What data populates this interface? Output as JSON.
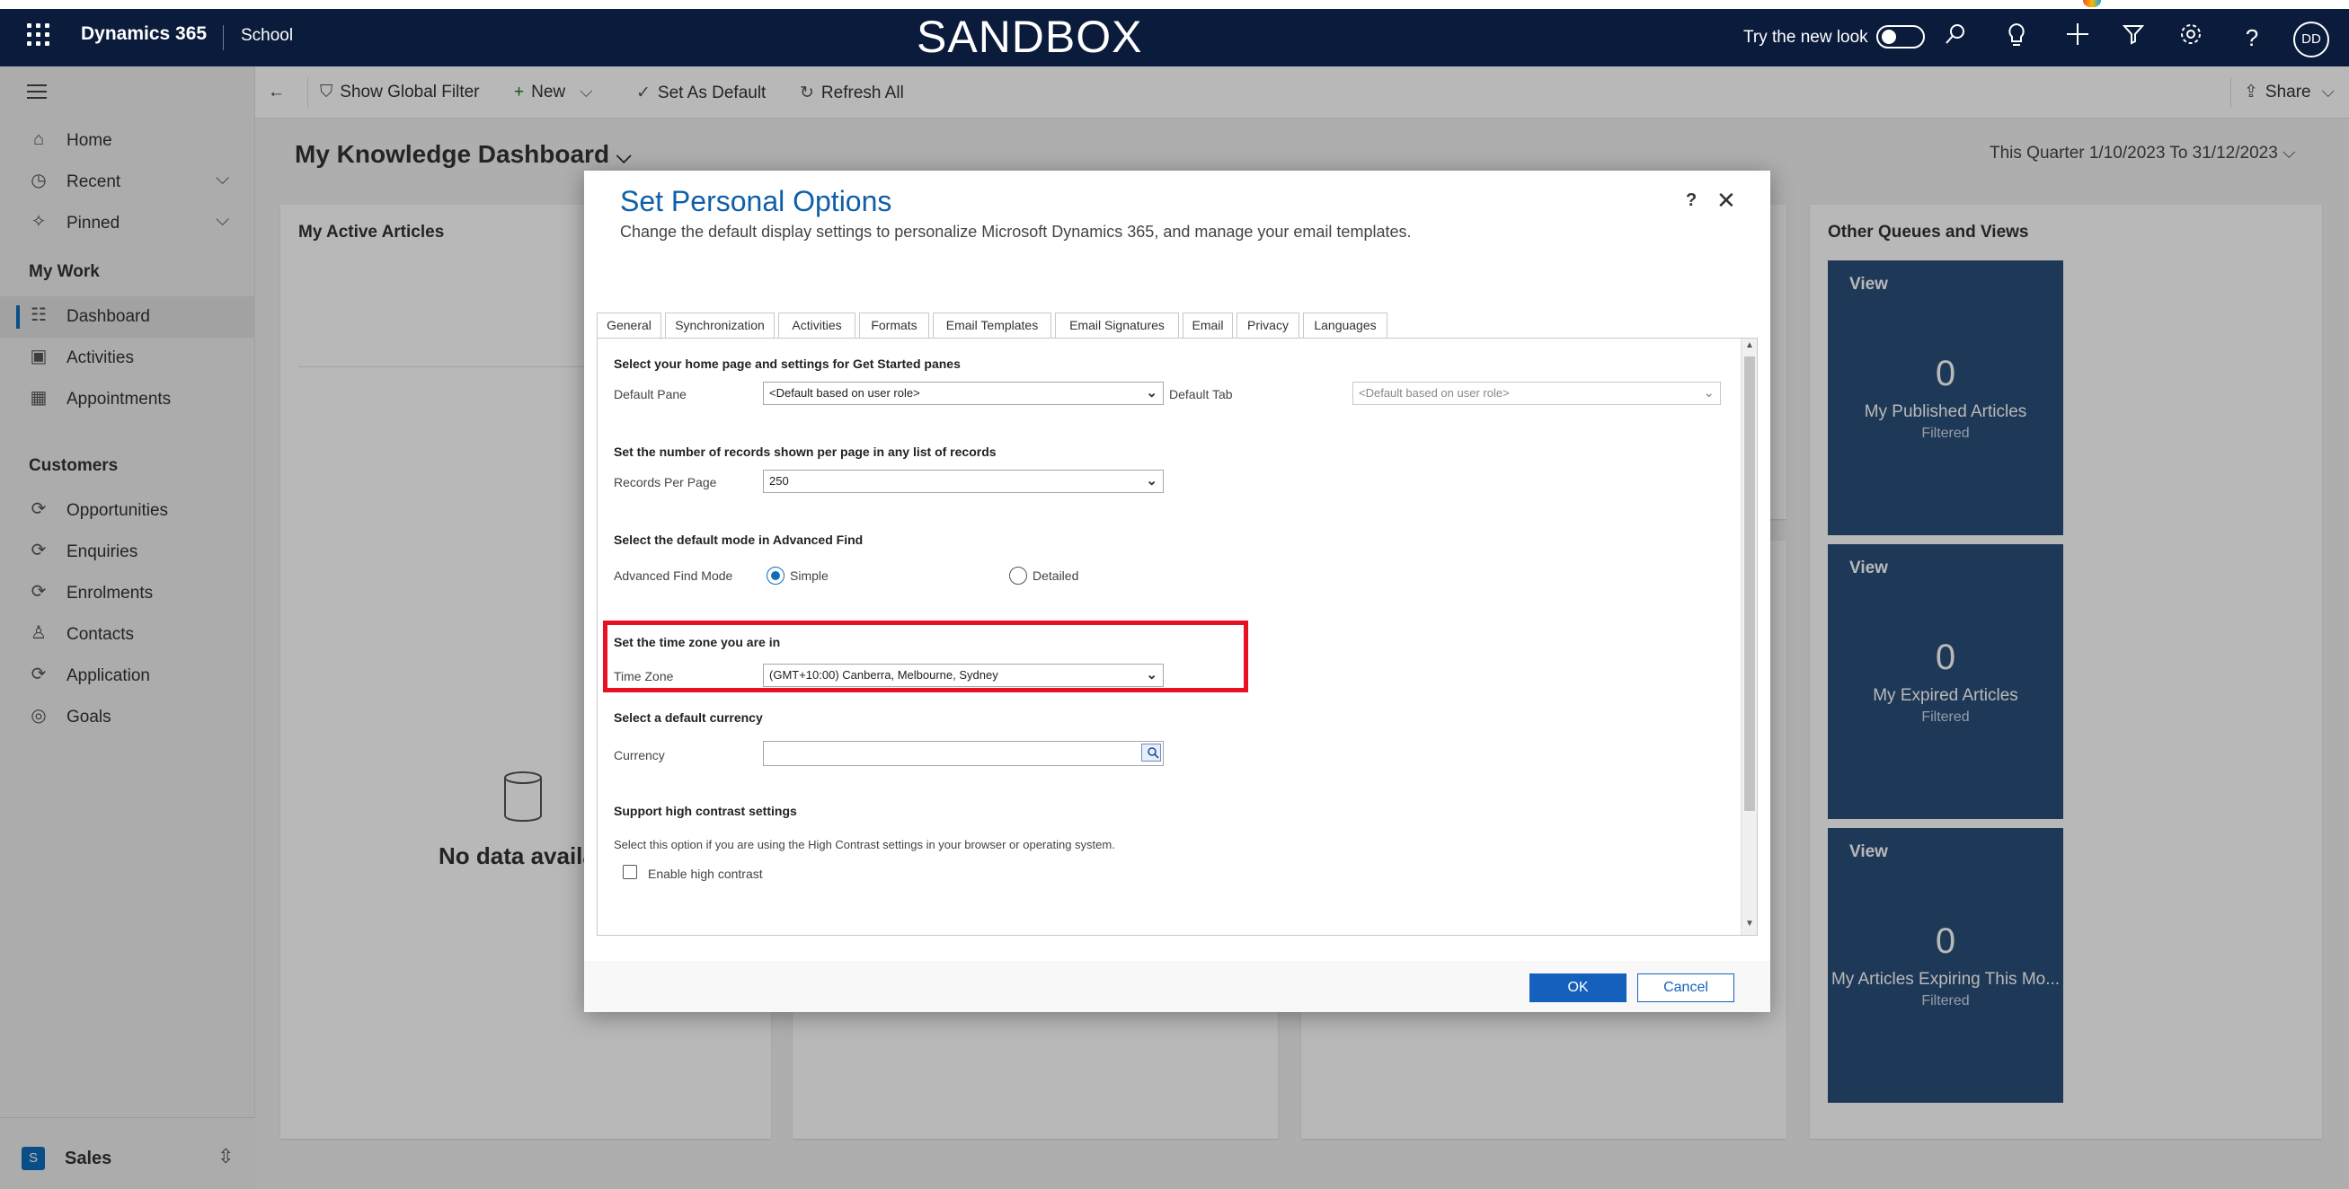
{
  "topbar": {
    "app_name": "Dynamics 365",
    "environment": "School",
    "banner": "SANDBOX",
    "try_new_look": "Try the new look",
    "avatar_initials": "DD"
  },
  "nav": {
    "items": [
      {
        "label": "Home",
        "icon": "home-icon"
      },
      {
        "label": "Recent",
        "icon": "clock-icon"
      },
      {
        "label": "Pinned",
        "icon": "pin-icon"
      }
    ],
    "my_work_header": "My Work",
    "my_work": [
      {
        "label": "Dashboard",
        "icon": "dashboard-icon"
      },
      {
        "label": "Activities",
        "icon": "clipboard-icon"
      },
      {
        "label": "Appointments",
        "icon": "calendar-icon"
      }
    ],
    "customers_header": "Customers",
    "customers": [
      {
        "label": "Opportunities",
        "icon": "entity-icon"
      },
      {
        "label": "Enquiries",
        "icon": "entity-icon"
      },
      {
        "label": "Enrolments",
        "icon": "entity-icon"
      },
      {
        "label": "Contacts",
        "icon": "person-icon"
      },
      {
        "label": "Application",
        "icon": "entity-icon"
      },
      {
        "label": "Goals",
        "icon": "target-icon"
      }
    ],
    "area_initial": "S",
    "area_label": "Sales"
  },
  "commandbar": {
    "show_global_filter": "Show Global Filter",
    "new": "New",
    "set_as_default": "Set As Default",
    "refresh_all": "Refresh All",
    "share": "Share"
  },
  "dashboard": {
    "title": "My Knowledge Dashboard",
    "filter": "This Quarter 1/10/2023 To 31/12/2023",
    "panel_active_articles": "My Active Articles",
    "no_data": "No data availal",
    "panel_other_queues": "Other Queues and Views",
    "tiles": [
      {
        "view": "View",
        "count": "0",
        "name": "My Published Articles",
        "sub": "Filtered"
      },
      {
        "view": "View",
        "count": "0",
        "name": "My Expired Articles",
        "sub": "Filtered"
      },
      {
        "view": "View",
        "count": "0",
        "name": "My Articles Expiring This Mo...",
        "sub": "Filtered"
      }
    ]
  },
  "dialog": {
    "title": "Set Personal Options",
    "subtitle": "Change the default display settings to personalize Microsoft Dynamics 365, and manage your email templates.",
    "help": "?",
    "tabs": [
      "General",
      "Synchronization",
      "Activities",
      "Formats",
      "Email Templates",
      "Email Signatures",
      "Email",
      "Privacy",
      "Languages"
    ],
    "sections": {
      "home": {
        "heading": "Select your home page and settings for Get Started panes",
        "pane_label": "Default Pane",
        "pane_value": "<Default based on user role>",
        "tab_label": "Default Tab",
        "tab_value": "<Default based on user role>"
      },
      "records": {
        "heading": "Set the number of records shown per page in any list of records",
        "label": "Records Per Page",
        "value": "250"
      },
      "advfind": {
        "heading": "Select the default mode in Advanced Find",
        "label": "Advanced Find Mode",
        "simple": "Simple",
        "detailed": "Detailed"
      },
      "timezone": {
        "heading": "Set the time zone you are in",
        "label": "Time Zone",
        "value": "(GMT+10:00) Canberra, Melbourne, Sydney"
      },
      "currency": {
        "heading": "Select a default currency",
        "label": "Currency",
        "value": ""
      },
      "contrast": {
        "heading": "Support high contrast settings",
        "desc": "Select this option if you are using the High Contrast settings in your browser or operating system.",
        "checkbox_label": "Enable high contrast"
      }
    },
    "ok": "OK",
    "cancel": "Cancel"
  },
  "colors": {
    "topbar": "#0b1b3b",
    "accent": "#0f6cbd",
    "tile": "#2a4e79",
    "highlight": "#e81123"
  }
}
